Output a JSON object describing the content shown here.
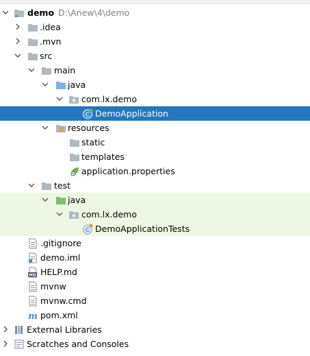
{
  "project_tree": {
    "root": {
      "name": "demo",
      "path": "D:\\Anew\\4\\demo"
    },
    "idea": ".idea",
    "mvn": ".mvn",
    "src": "src",
    "main": "main",
    "main_java": "java",
    "main_package": "com.lx.demo",
    "demo_application": "DemoApplication",
    "resources": "resources",
    "static": "static",
    "templates": "templates",
    "application_properties": "application.properties",
    "test": "test",
    "test_java": "java",
    "test_package": "com.lx.demo",
    "demo_application_tests": "DemoApplicationTests",
    "gitignore": ".gitignore",
    "demo_iml": "demo.iml",
    "help_md": "HELP.md",
    "mvnw": "mvnw",
    "mvnw_cmd": "mvnw.cmd",
    "pom_xml": "pom.xml",
    "external_libraries": "External Libraries",
    "scratches": "Scratches and Consoles"
  },
  "colors": {
    "selection": "#2675bf",
    "test_background": "#eef7e4",
    "folder": "#aeb9c0",
    "source_folder": "#79b4e0",
    "test_folder": "#7cbf6a",
    "spring": "#6db33f"
  }
}
